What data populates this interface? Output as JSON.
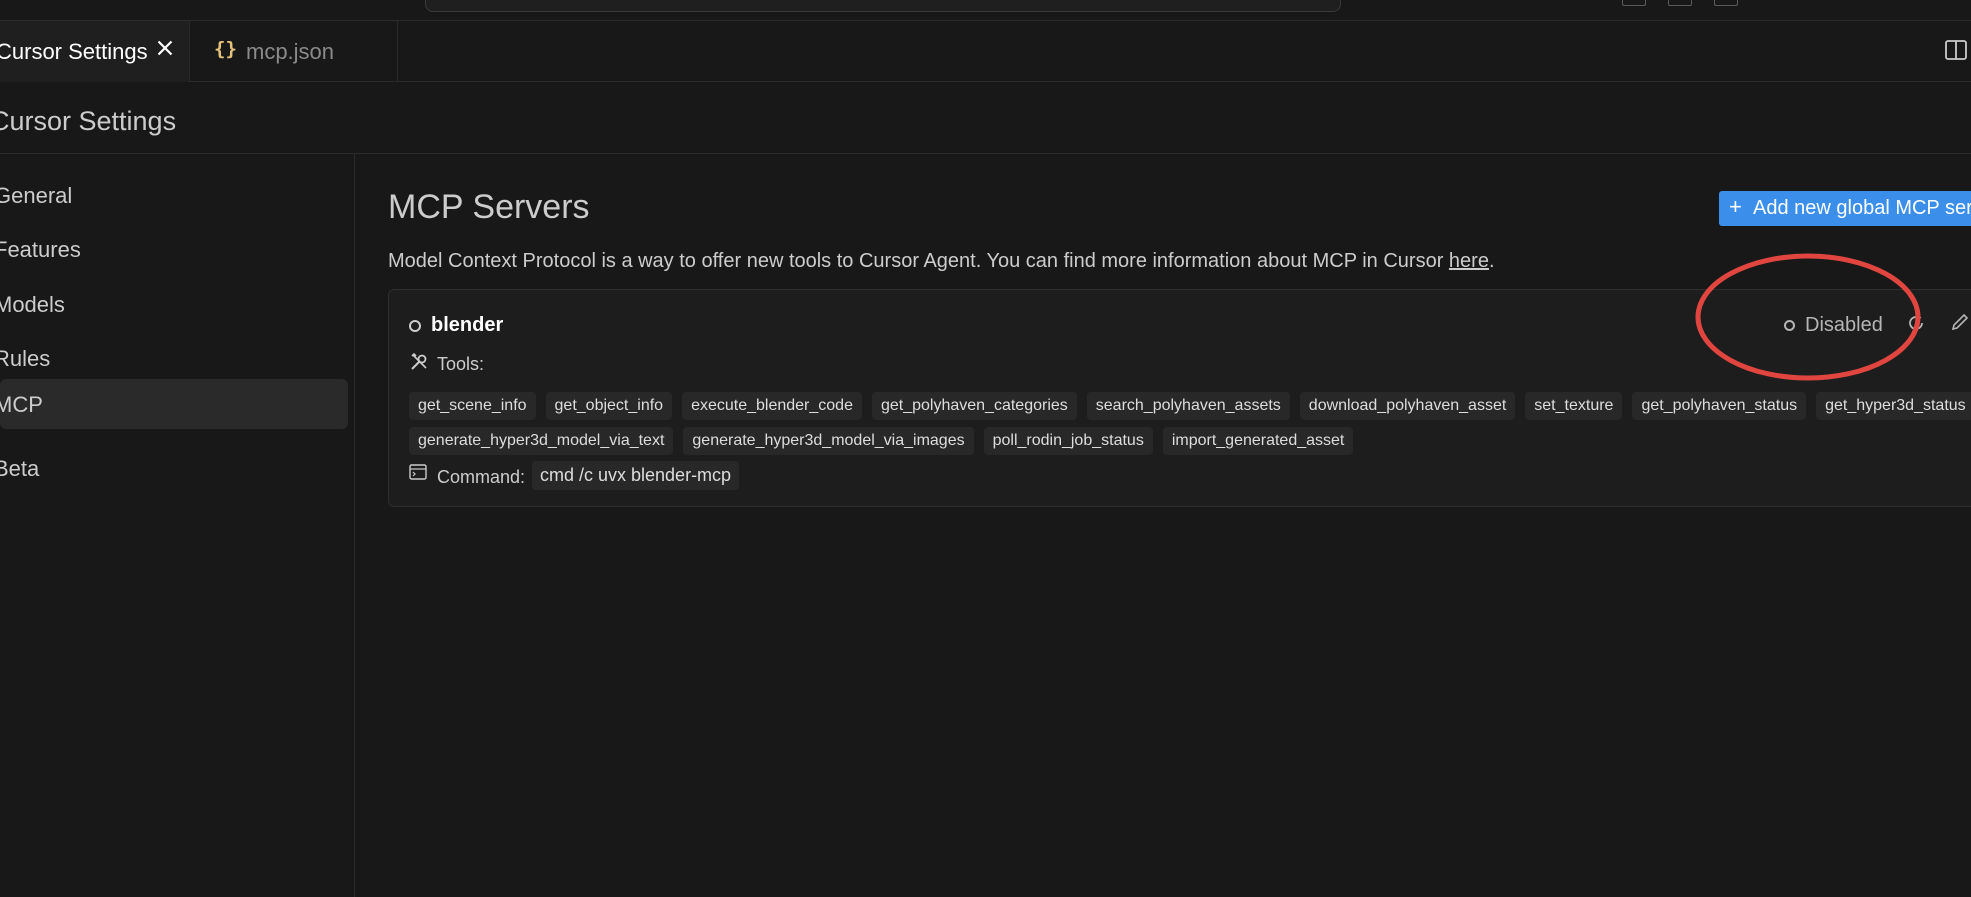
{
  "tabs": [
    {
      "label": "Cursor Settings",
      "active": true
    },
    {
      "label": "mcp.json",
      "active": false
    }
  ],
  "icons": {
    "json": "{}",
    "close": "close-icon",
    "split": "split-editor-icon",
    "tools": "tools-icon",
    "command": "terminal-icon",
    "refresh": "refresh-icon",
    "edit": "pencil-icon"
  },
  "settings": {
    "title": "Cursor Settings"
  },
  "sidebar": {
    "items": [
      {
        "label": "General",
        "active": false
      },
      {
        "label": "Features",
        "active": false
      },
      {
        "label": "Models",
        "active": false
      },
      {
        "label": "Rules",
        "active": false
      },
      {
        "label": "MCP",
        "active": true
      },
      {
        "label": "Beta",
        "active": false
      }
    ]
  },
  "main": {
    "title": "MCP Servers",
    "add_button": "Add new global MCP server",
    "description": "Model Context Protocol is a way to offer new tools to Cursor Agent. You can find more information about MCP in Cursor ",
    "link_text": "here",
    "description_end": "."
  },
  "server": {
    "name": "blender",
    "status": "Disabled",
    "tools_label": "Tools:",
    "tools_row1": [
      "get_scene_info",
      "get_object_info",
      "execute_blender_code",
      "get_polyhaven_categories",
      "search_polyhaven_assets",
      "download_polyhaven_asset",
      "set_texture",
      "get_polyhaven_status",
      "get_hyper3d_status"
    ],
    "tools_row2": [
      "generate_hyper3d_model_via_text",
      "generate_hyper3d_model_via_images",
      "poll_rodin_job_status",
      "import_generated_asset"
    ],
    "command_label": "Command:",
    "command": "cmd /c uvx blender-mcp"
  },
  "colors": {
    "background": "#181818",
    "accent_button": "#3b8eea",
    "annotation": "#e0453f",
    "json_icon": "#e5c07b"
  }
}
